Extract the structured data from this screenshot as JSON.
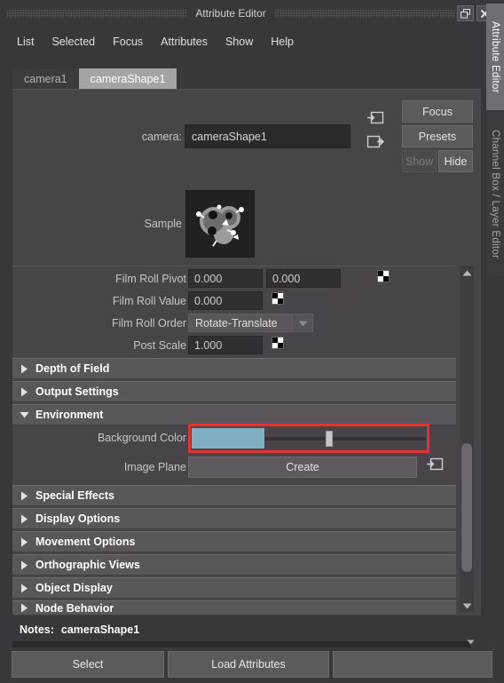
{
  "window": {
    "title": "Attribute Editor",
    "restore_icon": "restore-icon",
    "close_icon": "close-icon"
  },
  "menubar": {
    "items": [
      {
        "label": "List"
      },
      {
        "label": "Selected"
      },
      {
        "label": "Focus"
      },
      {
        "label": "Attributes"
      },
      {
        "label": "Show"
      },
      {
        "label": "Help"
      }
    ]
  },
  "node_tabs": [
    {
      "label": "camera1",
      "active": false
    },
    {
      "label": "cameraShape1",
      "active": true
    }
  ],
  "node_header": {
    "field_label": "camera:",
    "field_value": "cameraShape1",
    "input_connection_icon": "input-connection-icon",
    "output_connection_icon": "output-connection-icon",
    "focus_label": "Focus",
    "presets_label": "Presets",
    "show_label": "Show",
    "hide_label": "Hide"
  },
  "sample": {
    "label": "Sample"
  },
  "attributes": [
    {
      "label": "Film Roll Pivot",
      "value": "0.000",
      "value2": "0.000",
      "type": "double-number",
      "has_key": true
    },
    {
      "label": "Film Roll Value",
      "value": "0.000",
      "type": "number",
      "has_key": true
    },
    {
      "label": "Film Roll Order",
      "value": "Rotate-Translate",
      "type": "dropdown",
      "has_key": false
    },
    {
      "label": "Post Scale",
      "value": "1.000",
      "type": "number",
      "has_key": true
    }
  ],
  "sections": [
    {
      "label": "Depth of Field",
      "expanded": false
    },
    {
      "label": "Output Settings",
      "expanded": false
    },
    {
      "label": "Environment",
      "expanded": true
    },
    {
      "label": "Special Effects",
      "expanded": false
    },
    {
      "label": "Display Options",
      "expanded": false
    },
    {
      "label": "Movement Options",
      "expanded": false
    },
    {
      "label": "Orthographic Views",
      "expanded": false
    },
    {
      "label": "Object Display",
      "expanded": false
    },
    {
      "label": "Node Behavior",
      "expanded": false
    }
  ],
  "environment": {
    "background_color_label": "Background Color",
    "background_color_hex": "#80afc4",
    "slider_position_percent": 40,
    "highlight_color": "#e8312a",
    "image_plane_label": "Image Plane",
    "image_plane_button": "Create",
    "image_plane_icon": "output-connection-icon"
  },
  "notes": {
    "label": "Notes:",
    "value": "cameraShape1",
    "caret_icon": "chevron-down-icon"
  },
  "footer": {
    "buttons": [
      {
        "label": "Select"
      },
      {
        "label": "Load Attributes"
      },
      {
        "label": ""
      }
    ]
  },
  "side_tabs": [
    {
      "label": "Attribute Editor",
      "active": true
    },
    {
      "label": "Channel Box / Layer Editor",
      "active": false
    }
  ],
  "scrollbar": {
    "up_icon": "scroll-up-icon",
    "down_icon": "scroll-down-icon"
  }
}
